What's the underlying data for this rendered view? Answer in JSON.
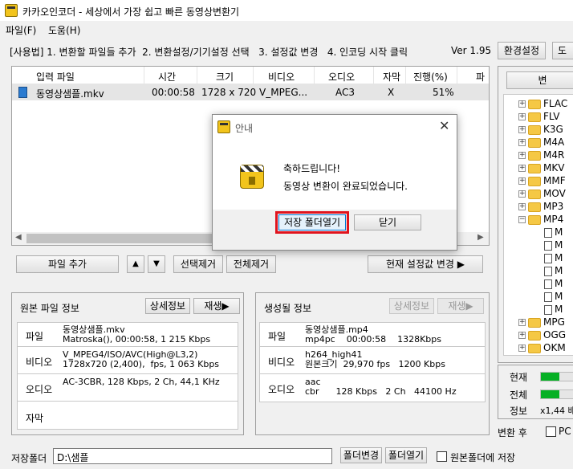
{
  "window": {
    "title": "카카오인코더 - 세상에서 가장 쉽고 빠른 동영상변환기"
  },
  "menu": {
    "file": "파일(F)",
    "help": "도움(H)"
  },
  "usage": {
    "text": "[사용법] 1. 변환할 파일들 추가  2. 변환설정/기기설정 선택   3. 설정값 변경   4. 인코딩 시작 클릭",
    "version": "Ver 1.95"
  },
  "toolbar": {
    "env_settings": "환경설정",
    "help_cut": "도"
  },
  "file_table": {
    "headers": [
      "입력 파일",
      "시간",
      "크기",
      "비디오",
      "오디오",
      "자막",
      "진행(%)",
      "파"
    ],
    "rows": [
      {
        "name": "동영상샘플.mkv",
        "time": "00:00:58",
        "size": "1728 x 720",
        "video": "V_MPEG...",
        "audio": "AC3",
        "subtitle": "X",
        "progress": "51%"
      }
    ]
  },
  "file_buttons": {
    "add": "파일 추가",
    "up": "▲",
    "down": "▼",
    "remove_selected": "선택제거",
    "remove_all": "전체제거",
    "apply_current": "현재 설정값 변경 ▶"
  },
  "source_info": {
    "title": "원본 파일 정보",
    "detail_btn": "상세정보",
    "play_btn": "재생▶",
    "rows": [
      {
        "key": "파일",
        "value": "동영상샘플.mkv\nMatroska(), 00:00:58, 1 215 Kbps"
      },
      {
        "key": "비디오",
        "value": "V_MPEG4/ISO/AVC(High@L3,2)\n1728x720 (2,400),  fps, 1 063 Kbps"
      },
      {
        "key": "오디오",
        "value": "AC-3CBR, 128 Kbps, 2 Ch, 44,1 KHz"
      },
      {
        "key": "자막",
        "value": ""
      }
    ]
  },
  "output_info": {
    "title": "생성될 정보",
    "detail_btn": "상세정보",
    "play_btn": "재생▶",
    "rows": [
      {
        "key": "파일",
        "value": "동영상샘플.mp4\nmp4pc    00:00:58    1328Kbps"
      },
      {
        "key": "비디오",
        "value": "h264_high41\n원본크기  29,970 fps   1200 Kbps"
      },
      {
        "key": "오디오",
        "value": "aac\ncbr      128 Kbps   2 Ch   44100 Hz"
      }
    ]
  },
  "save_folder": {
    "label": "저장폴더",
    "path": "D:\\샘플",
    "change_btn": "폴더변경",
    "open_btn": "폴더열기",
    "save_to_source": "원본폴더에 저장"
  },
  "right_panel": {
    "top_btn": "변",
    "tree": [
      {
        "label": "FLAC",
        "type": "folder"
      },
      {
        "label": "FLV",
        "type": "folder"
      },
      {
        "label": "K3G",
        "type": "folder"
      },
      {
        "label": "M4A",
        "type": "folder"
      },
      {
        "label": "M4R",
        "type": "folder"
      },
      {
        "label": "MKV",
        "type": "folder"
      },
      {
        "label": "MMF",
        "type": "folder"
      },
      {
        "label": "MOV",
        "type": "folder"
      },
      {
        "label": "MP3",
        "type": "folder"
      },
      {
        "label": "MP4",
        "type": "folder-open"
      },
      {
        "label": "M",
        "type": "doc"
      },
      {
        "label": "M",
        "type": "doc"
      },
      {
        "label": "M",
        "type": "doc"
      },
      {
        "label": "M",
        "type": "doc"
      },
      {
        "label": "M",
        "type": "doc"
      },
      {
        "label": "M",
        "type": "doc"
      },
      {
        "label": "M",
        "type": "doc"
      },
      {
        "label": "MPG",
        "type": "folder"
      },
      {
        "label": "OGG",
        "type": "folder"
      },
      {
        "label": "OKM",
        "type": "folder"
      }
    ],
    "progress": {
      "current_label": "현재",
      "total_label": "전체",
      "info_label": "정보",
      "info_value": "x1,44 배",
      "current": 0.51,
      "total": 0.51
    },
    "after_convert": "변환 후",
    "pc_option": "PC"
  },
  "dialog": {
    "title": "안내",
    "line1": "축하드립니다!",
    "line2": "동영상 변환이 완료되었습니다.",
    "open_folder_btn": "저장 폴더열기",
    "close_btn": "닫기",
    "highlight_color": "#e0141e"
  }
}
